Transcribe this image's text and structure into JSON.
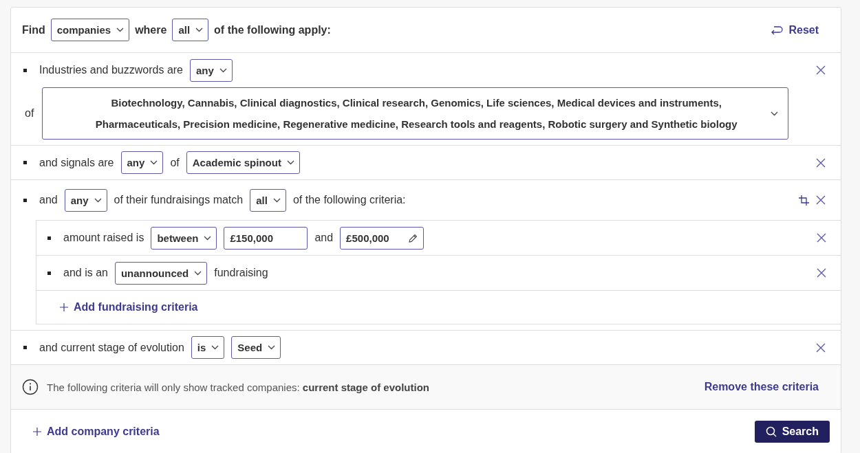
{
  "header": {
    "find_label": "Find",
    "entity": "companies",
    "where_label": "where",
    "quantifier": "all",
    "suffix": "of the following apply:",
    "reset": "Reset"
  },
  "criteria": [
    {
      "kind": "rule",
      "parts": [
        {
          "kind": "text",
          "text": "Industries and buzzwords are"
        },
        {
          "kind": "select",
          "value": "any"
        }
      ],
      "continuation": {
        "label": "of",
        "value": "Biotechnology, Cannabis, Clinical diagnostics, Clinical research, Genomics, Life sciences, Medical devices and instruments, Pharmaceuticals, Precision medicine, Regenerative medicine, Research tools and reagents, Robotic surgery and Synthetic biology"
      }
    },
    {
      "kind": "rule",
      "parts": [
        {
          "kind": "text",
          "text": "and signals are"
        },
        {
          "kind": "select",
          "value": "any"
        },
        {
          "kind": "text",
          "text": "of"
        },
        {
          "kind": "select",
          "value": "Academic spinout"
        }
      ]
    },
    {
      "kind": "group",
      "parts": [
        {
          "kind": "text",
          "text": "and"
        },
        {
          "kind": "select",
          "value": "any"
        },
        {
          "kind": "text",
          "text": "of their fundraisings match"
        },
        {
          "kind": "select",
          "value": "all"
        },
        {
          "kind": "text",
          "text": "of the following criteria:"
        }
      ],
      "children": [
        {
          "parts": [
            {
              "kind": "text",
              "text": "amount raised is"
            },
            {
              "kind": "select",
              "value": "between"
            },
            {
              "kind": "input",
              "value": "£150,000"
            },
            {
              "kind": "text",
              "text": "and"
            },
            {
              "kind": "input_edit",
              "value": "£500,000"
            }
          ]
        },
        {
          "parts": [
            {
              "kind": "text",
              "text": "and is an"
            },
            {
              "kind": "select",
              "value": "unannounced"
            },
            {
              "kind": "text",
              "text": "fundraising"
            }
          ]
        }
      ],
      "add_link": "Add fundraising criteria"
    },
    {
      "kind": "rule",
      "parts": [
        {
          "kind": "text",
          "text": "and current stage of evolution"
        },
        {
          "kind": "select",
          "value": "is"
        },
        {
          "kind": "select",
          "value": "Seed"
        }
      ]
    }
  ],
  "notice": {
    "text": "The following criteria will only show tracked companies: **current stage of evolution**",
    "action": "Remove these criteria"
  },
  "footer": {
    "add_link": "Add company criteria",
    "search": "Search"
  }
}
